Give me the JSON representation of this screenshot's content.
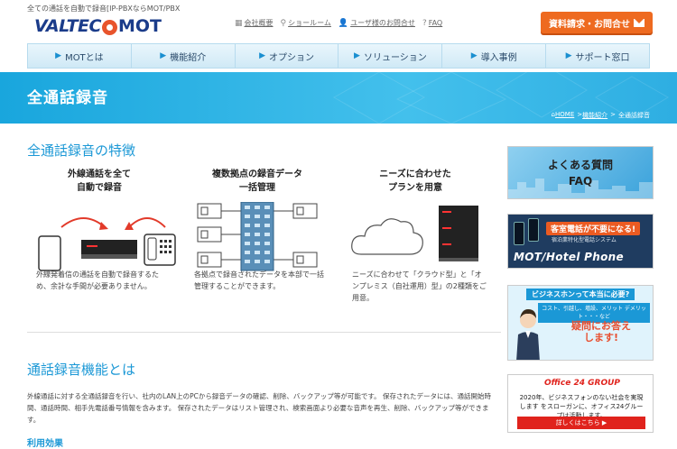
{
  "header": {
    "tagline": "全ての通話を自動で録音[IP-PBXならMOT/PBX",
    "logo_text1": "VALTEC",
    "logo_text2": "MOT",
    "links": [
      {
        "icon": "building-icon",
        "label": "会社概要"
      },
      {
        "icon": "search-icon",
        "label": "ショールーム"
      },
      {
        "icon": "user-icon",
        "label": "ユーザ様のお問合せ"
      },
      {
        "icon": "help-icon",
        "label": "FAQ"
      }
    ],
    "cta_label": "資料請求・お問合せ"
  },
  "nav": {
    "items": [
      "MOTとは",
      "機能紹介",
      "オプション",
      "ソリューション",
      "導入事例",
      "サポート窓口"
    ]
  },
  "hero": {
    "title": "全通話録音",
    "breadcrumb": [
      "HOME",
      "機能紹介",
      "全通話録音"
    ]
  },
  "main": {
    "features_title": "全通話録音の特徴",
    "features": [
      {
        "heading1": "外線通話を全て",
        "heading2": "自動で録音",
        "text": "外線発着信の通話を自動で録音するため、余計な手間が必要ありません。"
      },
      {
        "heading1": "複数拠点の録音データ",
        "heading2": "一括管理",
        "text": "各拠点で録音されたデータを本部で一括管理することができます。"
      },
      {
        "heading1": "ニーズに合わせた",
        "heading2": "プランを用意",
        "text": "ニーズに合わせて「クラウド型」と「オンプレミス（自社運用）型」の2種類をご用意。"
      }
    ],
    "section2_title": "通話録音機能とは",
    "section2_text": "外線通話に対する全通話録音を行い、社内のLAN上のPCから録音データの確認、削除、バックアップ等が可能です。 保存されたデータには、通話開始時間、通話時間、相手先電話番号情報を含みます。 保存されたデータはリスト管理され、検索画面より必要な音声を再生、削除、バックアップ等ができます。",
    "benefit_title": "利用効果"
  },
  "sidebar": {
    "faq_line1": "よくある質問",
    "faq_line2": "FAQ",
    "hotel_top": "客室電話が不要になる!",
    "hotel_sub": "宿泊業特化型電話システム",
    "hotel_big": "MOT/Hotel Phone",
    "biz_top": "ビジネスホンって本当に必要?",
    "biz_mid": "コスト、引越し、増設、メリット デメリット・・・など",
    "biz_q1": "疑問にお答え",
    "biz_q2": "します!",
    "o24_logo": "Office 24 GROUP",
    "o24_text": "2020年、ビジネスフォンのない社会を実現します をスローガンに、オフィス24グループは活動します。",
    "o24_btn": "詳しくはこちら ▶"
  }
}
